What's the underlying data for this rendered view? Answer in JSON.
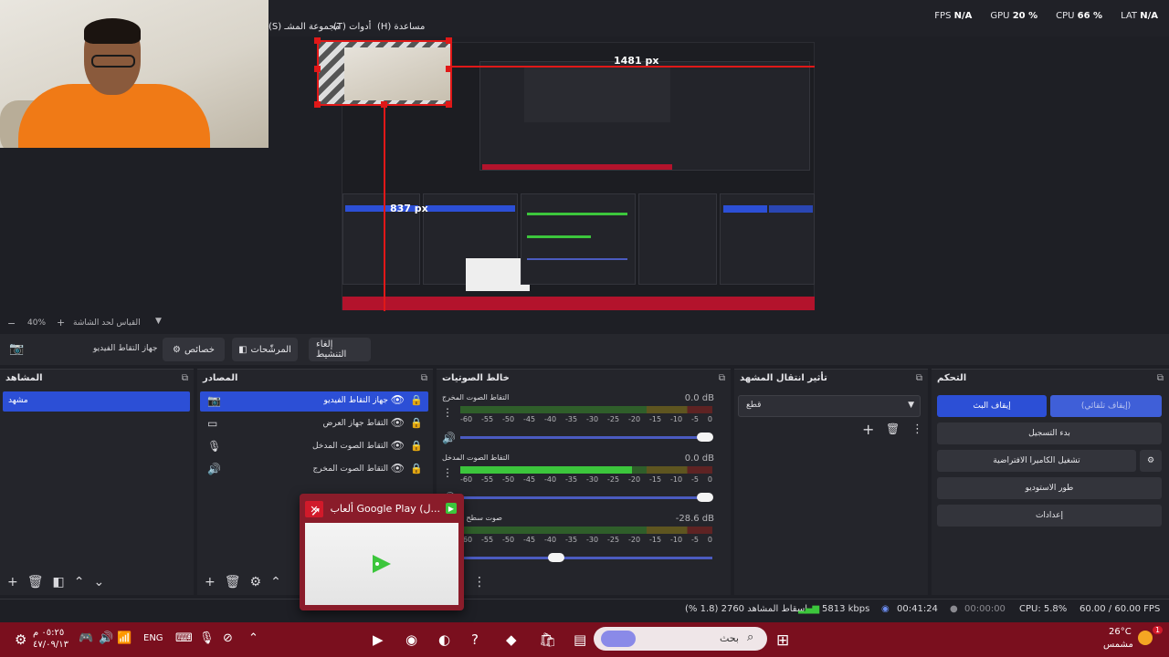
{
  "menu": {
    "scene_collection": "(S) مجموعة المشـ",
    "tools": "(T) أدوات",
    "help": "(H) مساعدة"
  },
  "stats": {
    "fps_label": "FPS",
    "fps_value": "N/A",
    "gpu_label": "GPU",
    "gpu_value": "20 %",
    "cpu_label": "CPU",
    "cpu_value": "66 %",
    "lat_label": "LAT",
    "lat_value": "N/A"
  },
  "preview": {
    "width_label": "1481 px",
    "height_label": "837 px"
  },
  "zoom": {
    "minus": "−",
    "value": "40%",
    "plus": "+",
    "fit_label": "القياس لحد الشاشة"
  },
  "source_toolbar": {
    "source_name": "جهاز التقاط الفيديو",
    "properties": "خصائص",
    "filters": "المرشّحات",
    "deactivate": "إلغاء التنشيط"
  },
  "scenes": {
    "title": "المشاهد",
    "items": [
      {
        "label": "مشهد"
      }
    ]
  },
  "sources": {
    "title": "المصادر",
    "items": [
      {
        "label": "جهاز التقاط الفيديو",
        "icon": "camera-icon"
      },
      {
        "label": "التقاط جهاز العرض",
        "icon": "monitor-icon"
      },
      {
        "label": "التقاط الصوت المدخل",
        "icon": "mic-icon"
      },
      {
        "label": "التقاط الصوت المخرج",
        "icon": "speaker-icon"
      }
    ]
  },
  "mixer": {
    "title": "خالط الصوتيات",
    "scale": [
      "-60",
      "-55",
      "-50",
      "-45",
      "-40",
      "-35",
      "-30",
      "-25",
      "-20",
      "-15",
      "-10",
      "-5",
      "0"
    ],
    "channels": [
      {
        "name": "التقاط الصوت المخرج",
        "db": "0.0 dB",
        "level": 0.0,
        "volume": 0.97
      },
      {
        "name": "التقاط الصوت المدخل",
        "db": "0.0 dB",
        "level": 0.68,
        "volume": 0.97
      },
      {
        "name": "صوت سطح المكتب",
        "db": "-28.6 dB",
        "level": 0.0,
        "volume": 0.38
      }
    ]
  },
  "transitions": {
    "title": "تأثير انتقال المشهد",
    "selected": "قطع"
  },
  "controls": {
    "title": "التحكم",
    "stop_stream": "إيقاف البث",
    "stop_auto": "(إيقاف تلقائي)",
    "start_recording": "بدء التسجيل",
    "virtual_camera": "تشغيل الكاميرا الافتراضية",
    "studio_mode": "طور الاستوديو",
    "settings": "إعدادات"
  },
  "status": {
    "dropped": "إسقاط المشاهد 2760 (1.8 %)",
    "bitrate": "5813 kbps",
    "stream_time": "00:41:24",
    "rec_time": "00:00:00",
    "cpu": "CPU: 5.8%",
    "fps": "60.00 / 60.00 FPS"
  },
  "popup": {
    "title": "ألعاب Google Play (ل...",
    "close": "✕"
  },
  "taskbar": {
    "time": "٠٥:٢٥ م",
    "date": "٤٧/٠٩/١٣",
    "lang": "ENG",
    "search": "بحث",
    "weather_temp": "26°C",
    "weather_desc": "مشمس",
    "notification_count": "1"
  },
  "colors": {
    "accent_blue": "#2c4fd6",
    "taskbar_red": "#7a0f1e",
    "meter_green": "#3cc63c",
    "selection_red": "#e01818"
  }
}
